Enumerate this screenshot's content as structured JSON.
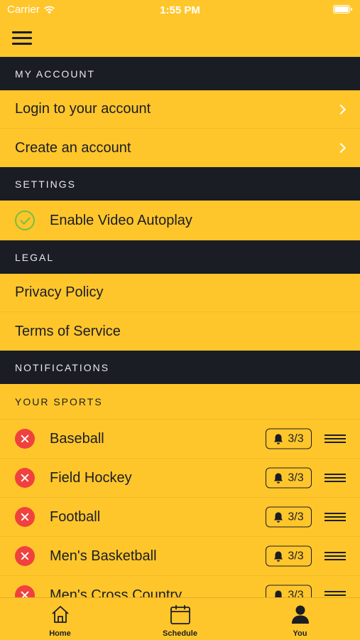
{
  "status": {
    "carrier": "Carrier",
    "time": "1:55 PM"
  },
  "sections": {
    "my_account": "MY ACCOUNT",
    "settings": "SETTINGS",
    "legal": "LEGAL",
    "notifications": "NOTIFICATIONS"
  },
  "account_rows": [
    {
      "label": "Login to your account"
    },
    {
      "label": "Create an account"
    }
  ],
  "settings_rows": [
    {
      "label": "Enable Video Autoplay",
      "enabled": true
    }
  ],
  "legal_rows": [
    {
      "label": "Privacy Policy"
    },
    {
      "label": "Terms of Service"
    }
  ],
  "your_sports_label": "YOUR SPORTS",
  "sports": [
    {
      "name": "Baseball",
      "alerts": "3/3"
    },
    {
      "name": "Field Hockey",
      "alerts": "3/3"
    },
    {
      "name": "Football",
      "alerts": "3/3"
    },
    {
      "name": "Men's Basketball",
      "alerts": "3/3"
    },
    {
      "name": "Men's Cross Country",
      "alerts": "3/3"
    }
  ],
  "tabs": [
    {
      "label": "Home",
      "icon": "home-icon"
    },
    {
      "label": "Schedule",
      "icon": "calendar-icon"
    },
    {
      "label": "You",
      "icon": "person-icon"
    }
  ],
  "colors": {
    "accent": "#FFC62B",
    "header_bg": "#1B1D24",
    "remove": "#F0413E",
    "check": "#74C043"
  }
}
